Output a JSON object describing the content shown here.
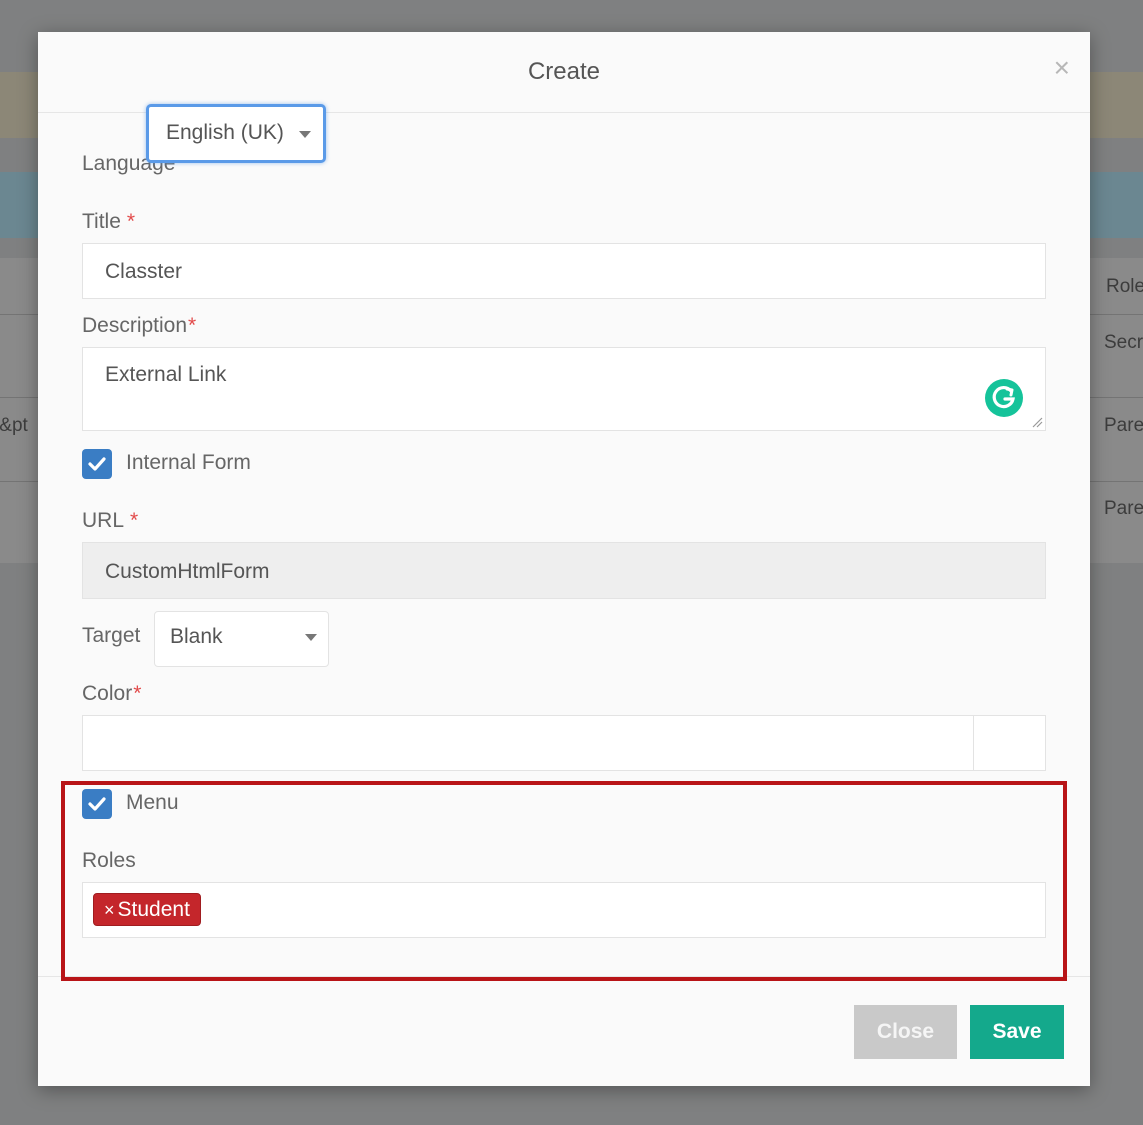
{
  "modal": {
    "title": "Create",
    "close_icon": "×"
  },
  "form": {
    "language": {
      "label": "Language",
      "value": "English (UK)"
    },
    "title": {
      "label": "Title",
      "required": "*",
      "value": "Classter"
    },
    "description": {
      "label": "Description",
      "required": "*",
      "value": "External Link"
    },
    "internal_form": {
      "label": "Internal Form",
      "checked": true
    },
    "url": {
      "label": "URL",
      "required": "*",
      "value": "CustomHtmlForm"
    },
    "target": {
      "label": "Target",
      "value": "Blank"
    },
    "color": {
      "label": "Color",
      "required": "*",
      "value": ""
    },
    "menu": {
      "label": "Menu",
      "checked": true
    },
    "roles": {
      "label": "Roles",
      "tags": [
        {
          "remove": "×",
          "label": "Student"
        }
      ]
    }
  },
  "footer": {
    "close_label": "Close",
    "save_label": "Save"
  },
  "background": {
    "column_header": "Role",
    "cells": [
      "Secr",
      "Pare",
      "Pare"
    ],
    "left_cell": "t&pt"
  },
  "colors": {
    "accent": "#3a7dc4",
    "save": "#14a98c",
    "tag": "#c4262b",
    "highlight": "#b81417"
  }
}
